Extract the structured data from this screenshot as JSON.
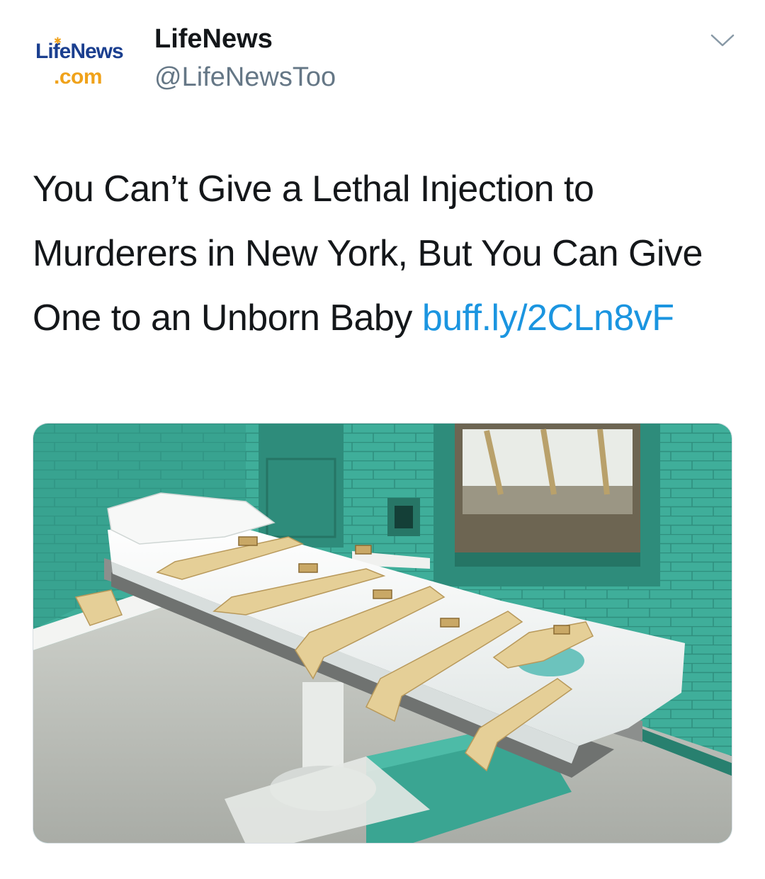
{
  "tweet": {
    "avatar": {
      "icon": "lifenews-logo-icon",
      "logo_top": "LifeNews",
      "logo_bottom": ".com"
    },
    "author_name": "LifeNews",
    "author_handle": "@LifeNewsToo",
    "menu_icon": "chevron-down-icon",
    "text": "You Can’t Give a Lethal Injection to Murderers in New York, But You Can Give One to an Unborn Baby ",
    "link_text": "buff.ly/2CLn8vF",
    "link_color": "#1b95e0",
    "media": {
      "icon": "execution-chamber-photo"
    }
  },
  "colors": {
    "text": "#14171a",
    "secondary": "#657786",
    "brand_blue": "#1b3f8f",
    "brand_orange": "#f0a21a",
    "wall_teal": "#3fae9a"
  }
}
